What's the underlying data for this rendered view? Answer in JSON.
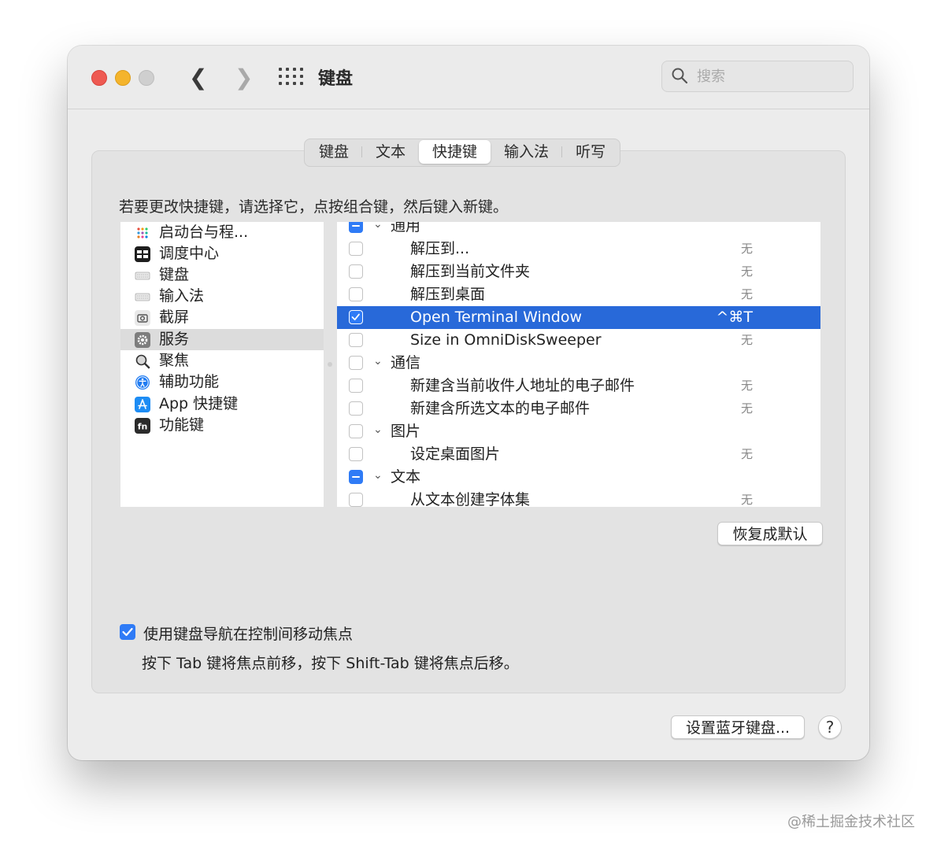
{
  "window": {
    "title": "键盘",
    "search_placeholder": "搜索"
  },
  "tabs": [
    {
      "label": "键盘",
      "active": false
    },
    {
      "label": "文本",
      "active": false
    },
    {
      "label": "快捷键",
      "active": true
    },
    {
      "label": "输入法",
      "active": false
    },
    {
      "label": "听写",
      "active": false
    }
  ],
  "instruction": "若要更改快捷键，请选择它，点按组合键，然后键入新键。",
  "categories": [
    {
      "label": "启动台与程...",
      "icon": "launchpad-icon"
    },
    {
      "label": "调度中心",
      "icon": "mission-control-icon"
    },
    {
      "label": "键盘",
      "icon": "keyboard-icon"
    },
    {
      "label": "输入法",
      "icon": "input-method-icon"
    },
    {
      "label": "截屏",
      "icon": "screenshot-icon"
    },
    {
      "label": "服务",
      "icon": "services-gear-icon",
      "selected": true
    },
    {
      "label": "聚焦",
      "icon": "spotlight-icon"
    },
    {
      "label": "辅助功能",
      "icon": "accessibility-icon"
    },
    {
      "label": "App 快捷键",
      "icon": "app-store-icon"
    },
    {
      "label": "功能键",
      "icon": "fn-key-icon"
    }
  ],
  "services": [
    {
      "type": "group",
      "label": "通用",
      "check": "mixed"
    },
    {
      "type": "item",
      "label": "解压到...",
      "shortcut": "无",
      "check": "off"
    },
    {
      "type": "item",
      "label": "解压到当前文件夹",
      "shortcut": "无",
      "check": "off"
    },
    {
      "type": "item",
      "label": "解压到桌面",
      "shortcut": "无",
      "check": "off"
    },
    {
      "type": "item",
      "label": "Open Terminal Window",
      "shortcut": "^⌘T",
      "check": "on",
      "selected": true
    },
    {
      "type": "item",
      "label": "Size in OmniDiskSweeper",
      "shortcut": "无",
      "check": "off"
    },
    {
      "type": "group",
      "label": "通信",
      "check": "off"
    },
    {
      "type": "item",
      "label": "新建含当前收件人地址的电子邮件",
      "shortcut": "无",
      "check": "off"
    },
    {
      "type": "item",
      "label": "新建含所选文本的电子邮件",
      "shortcut": "无",
      "check": "off"
    },
    {
      "type": "group",
      "label": "图片",
      "check": "off"
    },
    {
      "type": "item",
      "label": "设定桌面图片",
      "shortcut": "无",
      "check": "off"
    },
    {
      "type": "group",
      "label": "文本",
      "check": "mixed"
    },
    {
      "type": "item",
      "label": "从文本创建字体集",
      "shortcut": "无",
      "check": "off"
    }
  ],
  "buttons": {
    "restore_default": "恢复成默认",
    "setup_bluetooth_keyboard": "设置蓝牙键盘...",
    "help": "?"
  },
  "keyboard_navigation": {
    "checked": true,
    "label": "使用键盘导航在控制间移动焦点",
    "hint": "按下 Tab 键将焦点前移，按下 Shift-Tab 键将焦点后移。"
  },
  "watermark": "@稀土掘金技术社区",
  "colors": {
    "accent": "#2f7bf6",
    "selection": "#2869d9",
    "close": "#ee5a52",
    "minimize": "#f4b42c"
  }
}
